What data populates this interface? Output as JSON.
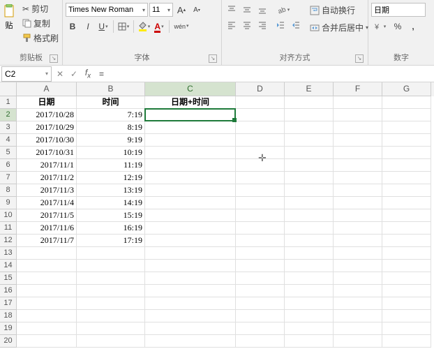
{
  "ribbon": {
    "clipboard": {
      "paste": "贴",
      "cut": "剪切",
      "copy": "复制",
      "format_painter": "格式刷",
      "group": "剪贴板"
    },
    "font": {
      "name": "Times New Roman",
      "size": "11",
      "group": "字体",
      "ruby": "wén"
    },
    "alignment": {
      "wrap": "自动换行",
      "merge": "合并后居中",
      "group": "对齐方式"
    },
    "number": {
      "format": "日期",
      "group": "数字"
    }
  },
  "formula_bar": {
    "name_box": "C2",
    "formula": "="
  },
  "columns": [
    "A",
    "B",
    "C",
    "D",
    "E",
    "F",
    "G"
  ],
  "headers": {
    "A": "日期",
    "B": "时间",
    "C": "日期+时间"
  },
  "data": [
    {
      "A": "2017/10/28",
      "B": "7:19",
      "C": "="
    },
    {
      "A": "2017/10/29",
      "B": "8:19"
    },
    {
      "A": "2017/10/30",
      "B": "9:19"
    },
    {
      "A": "2017/10/31",
      "B": "10:19"
    },
    {
      "A": "2017/11/1",
      "B": "11:19"
    },
    {
      "A": "2017/11/2",
      "B": "12:19"
    },
    {
      "A": "2017/11/3",
      "B": "13:19"
    },
    {
      "A": "2017/11/4",
      "B": "14:19"
    },
    {
      "A": "2017/11/5",
      "B": "15:19"
    },
    {
      "A": "2017/11/6",
      "B": "16:19"
    },
    {
      "A": "2017/11/7",
      "B": "17:19"
    }
  ],
  "active_cell": "C2",
  "total_rows": 20
}
